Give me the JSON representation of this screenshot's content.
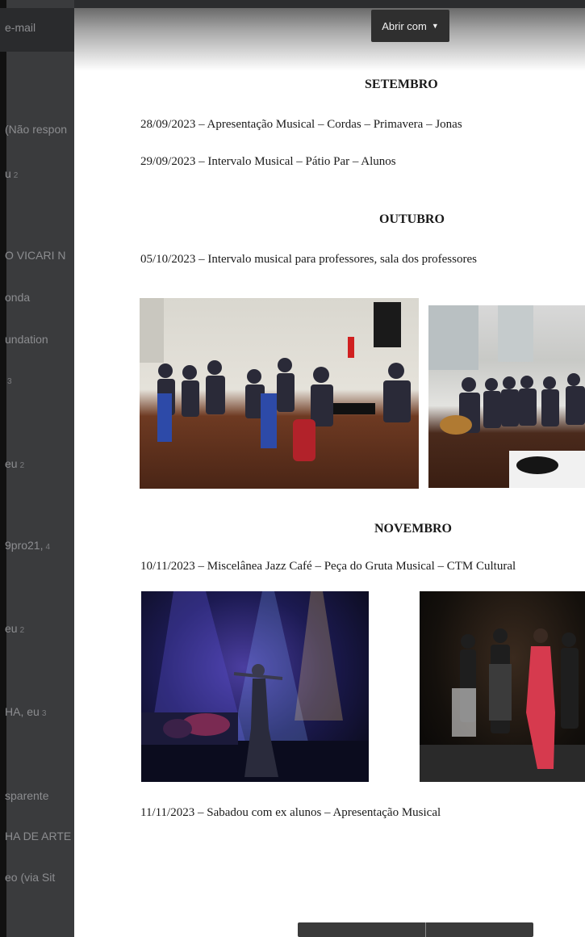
{
  "background_inbox": {
    "items": [
      {
        "text": "e-mail"
      },
      {
        "text": "(Não respon"
      },
      {
        "text": "u",
        "count": "2"
      },
      {
        "text": "O VICARI N"
      },
      {
        "text": "onda"
      },
      {
        "text": "undation"
      },
      {
        "text": "3"
      },
      {
        "text": "eu",
        "count": "2"
      },
      {
        "text": "9pro21,",
        "count": "4"
      },
      {
        "text": "eu",
        "count": "2"
      },
      {
        "text": "HA, eu",
        "count": "3"
      },
      {
        "text": "sparente"
      },
      {
        "text": "HA DE ARTE"
      },
      {
        "text": "eo (via Sit"
      }
    ]
  },
  "viewer": {
    "open_with_label": "Abrir com",
    "sections": {
      "setembro": {
        "title": "SETEMBRO",
        "lines": [
          "28/09/2023 – Apresentação Musical – Cordas – Primavera – Jonas",
          "29/09/2023 – Intervalo Musical – Pátio Par – Alunos"
        ]
      },
      "outubro": {
        "title": "OUTUBRO",
        "lines": [
          "05/10/2023 – Intervalo musical para professores, sala dos professores"
        ]
      },
      "novembro": {
        "title": "NOVEMBRO",
        "lines": [
          "10/11/2023 – Miscelânea Jazz Café – Peça do Gruta Musical – CTM Cultural",
          "11/11/2023 – Sabadou com ex alunos – Apresentação Musical"
        ]
      }
    }
  },
  "colors": {
    "viewer_bg": "#ffffff",
    "overlay_dark": "#2b2c2e",
    "button_bg": "#2f2f2f"
  }
}
